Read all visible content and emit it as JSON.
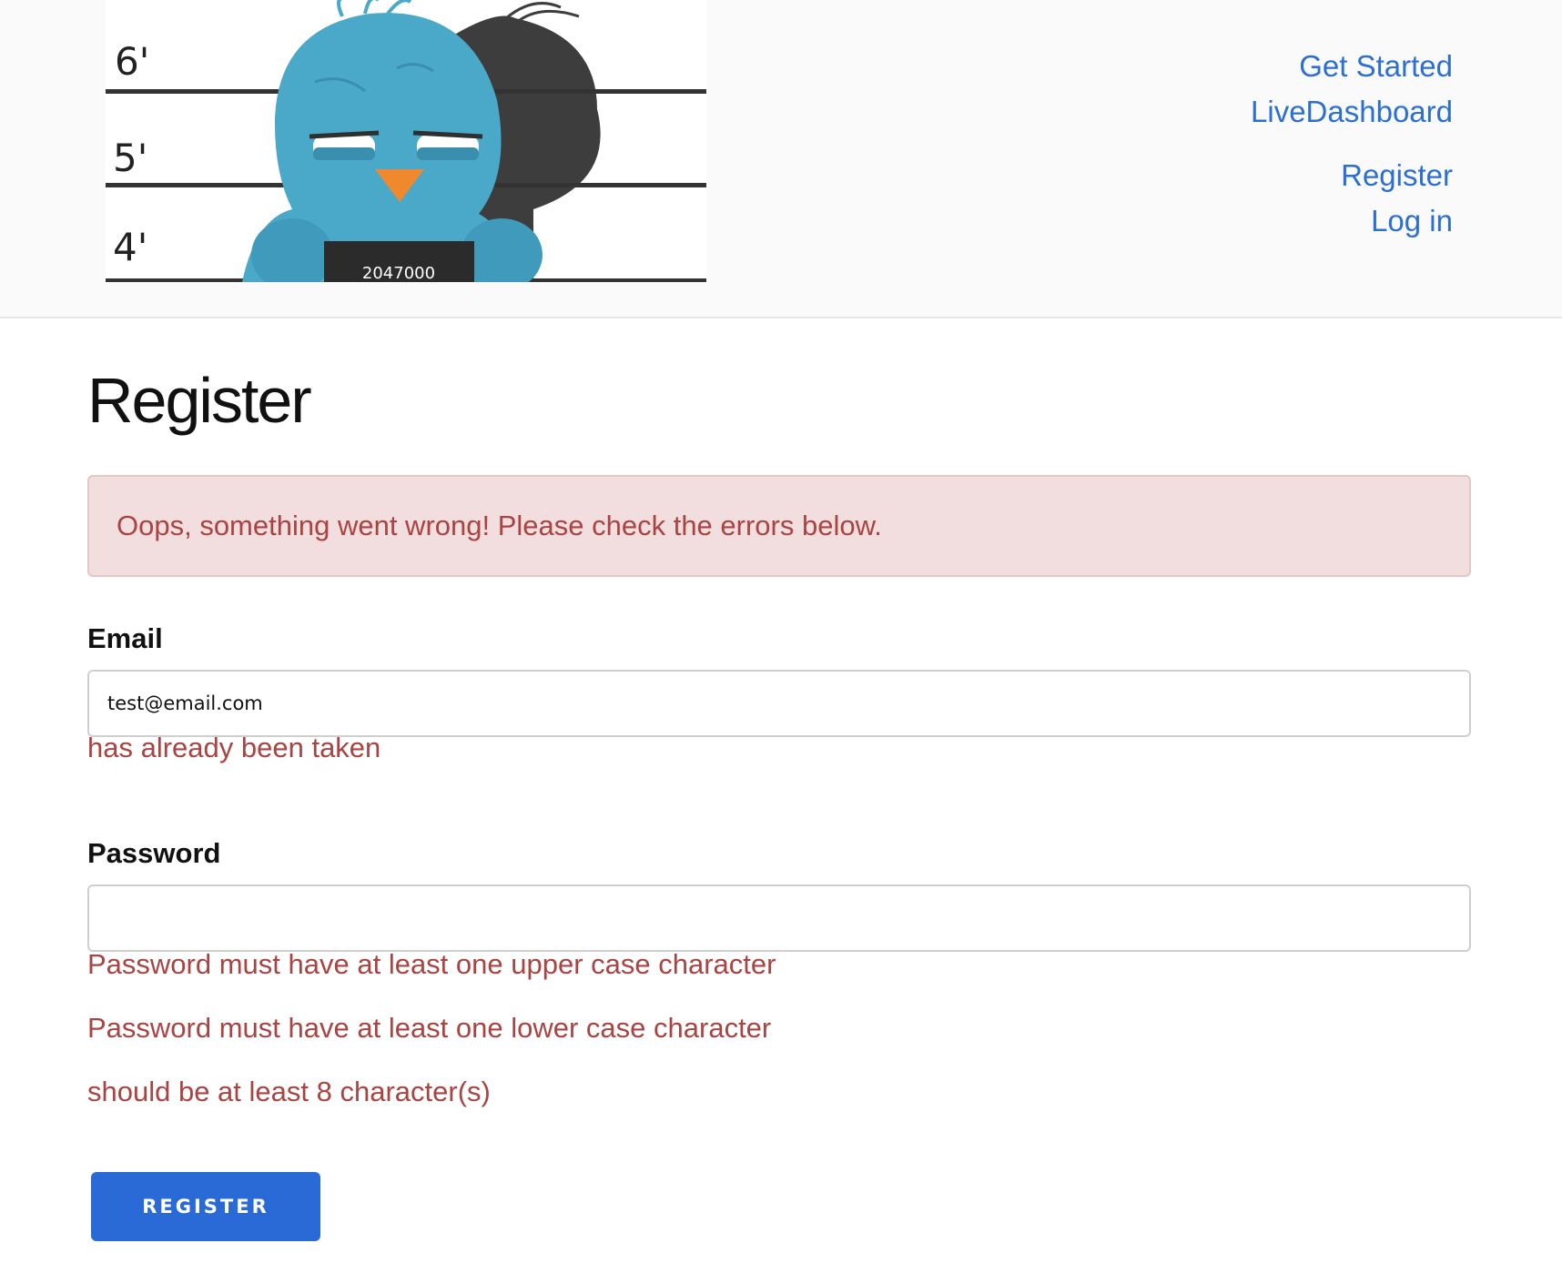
{
  "header": {
    "logo": {
      "ruler_labels": [
        "6'",
        "5'",
        "4'"
      ],
      "placard_text": "2047000"
    },
    "nav": {
      "get_started": "Get Started",
      "live_dashboard": "LiveDashboard",
      "register": "Register",
      "log_in": "Log in"
    }
  },
  "page": {
    "title": "Register",
    "alert": "Oops, something went wrong! Please check the errors below."
  },
  "form": {
    "email": {
      "label": "Email",
      "value": "test@email.com",
      "errors": [
        "has already been taken"
      ]
    },
    "password": {
      "label": "Password",
      "value": "",
      "errors": [
        "Password must have at least one upper case character",
        "Password must have at least one lower case character",
        "should be at least 8 character(s)"
      ]
    },
    "submit_label": "REGISTER"
  },
  "colors": {
    "link": "#2b6fd4",
    "error_text": "#a94442",
    "alert_bg": "#f2dede",
    "button": "#2a6ad6",
    "bird_body": "#4aa8c8",
    "bird_beak": "#f0892e"
  }
}
